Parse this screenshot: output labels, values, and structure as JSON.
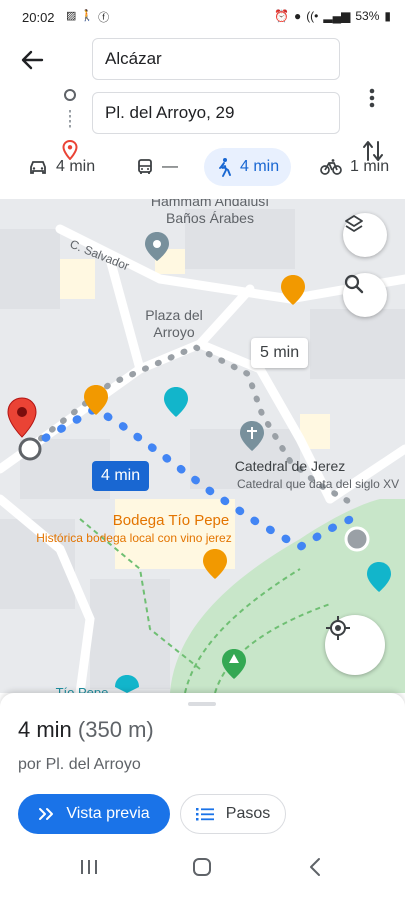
{
  "status_bar": {
    "time": "20:02",
    "battery": "53%"
  },
  "directions": {
    "origin": "Alcázar",
    "destination": "Pl. del Arroyo, 29"
  },
  "travel_modes": [
    {
      "name": "car",
      "label": "4 min"
    },
    {
      "name": "transit",
      "label": "—"
    },
    {
      "name": "walk",
      "label": "4 min"
    },
    {
      "name": "bike",
      "label": "1 min"
    }
  ],
  "map": {
    "labels": {
      "hammam_line1": "Hammam Andalusí",
      "hammam_line2": "Baños Árabes",
      "street_salvador": "C. Salvador",
      "plaza_line1": "Plaza del",
      "plaza_line2": "Arroyo",
      "catedral": "Catedral de Jerez",
      "catedral_sub": "Catedral que data del siglo XV",
      "bodega": "Bodega Tío Pepe",
      "bodega_sub": "Histórica bodega local con vino jerez",
      "tio_pepe": "Tío Pepe"
    },
    "route_time_primary": "4 min",
    "route_time_alt": "5 min",
    "colors": {
      "route": "#4285f4",
      "route_alt": "#8e8e8e",
      "park": "#c8e6c9",
      "destination_pin": "#ea4335",
      "food_poi": "#f29900",
      "attraction_poi": "#12b5cb",
      "poi_gray": "#78909c"
    }
  },
  "sheet": {
    "duration": "4 min",
    "distance": "(350 m)",
    "via": "por Pl. del Arroyo",
    "preview_label": "Vista previa",
    "steps_label": "Pasos"
  }
}
